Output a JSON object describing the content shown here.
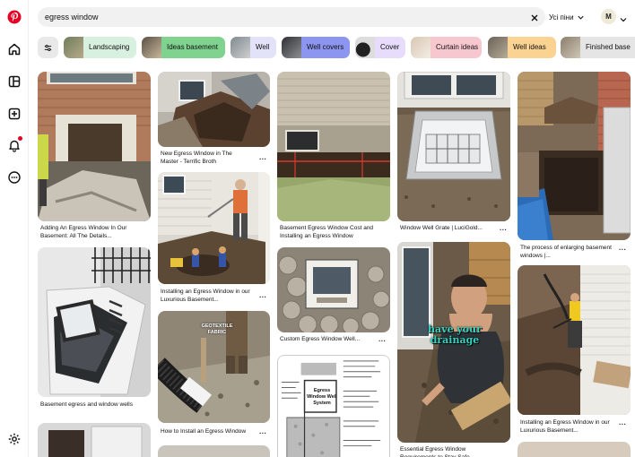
{
  "search": {
    "value": "egress window"
  },
  "filter": {
    "label": "Усі піни"
  },
  "user": {
    "initial": "M"
  },
  "chips": [
    {
      "label": "Landscaping",
      "bg": "#d8f0df"
    },
    {
      "label": "Ideas basement",
      "bg": "#7fd38f"
    },
    {
      "label": "Well",
      "bg": "#e2e2f8"
    },
    {
      "label": "Well covers",
      "bg": "#8c95f0"
    },
    {
      "label": "Cover",
      "bg": "#e7dcfb"
    },
    {
      "label": "Curtain ideas",
      "bg": "#f7c7d0"
    },
    {
      "label": "Well ideas",
      "bg": "#fad393"
    },
    {
      "label": "Finished base",
      "bg": "#e5e5e5"
    }
  ],
  "pins": [
    {
      "caption": "Adding An Egress Window In Our Basement: All The Details..."
    },
    {
      "caption": "Basement egress and window wells"
    },
    {
      "caption": "New Egress Window in The Master - Terrific Broth"
    },
    {
      "caption": "Installing an Egress Window in our Luxurious Basement..."
    },
    {
      "caption": "How to Install an Egress Window"
    },
    {
      "caption": "Basement Egress Window Cost and Installing an Egress Window"
    },
    {
      "caption": "Custom Egress Window Well..."
    },
    {
      "caption": "Window Well Grate | LuciGold..."
    },
    {
      "caption": "Essential Egress Window Requirements to Stay Safe"
    },
    {
      "caption": "The process of enlarging basement windows |..."
    },
    {
      "caption": "Installing an Egress Window in our Luxurious Basement..."
    }
  ],
  "overlays": {
    "geotextile": "GEOTEXTILE FABRIC",
    "drainage_line1": "have your",
    "drainage_line2": "drainage",
    "diagram_title": "Egress Window Well System"
  },
  "more_label": "..."
}
